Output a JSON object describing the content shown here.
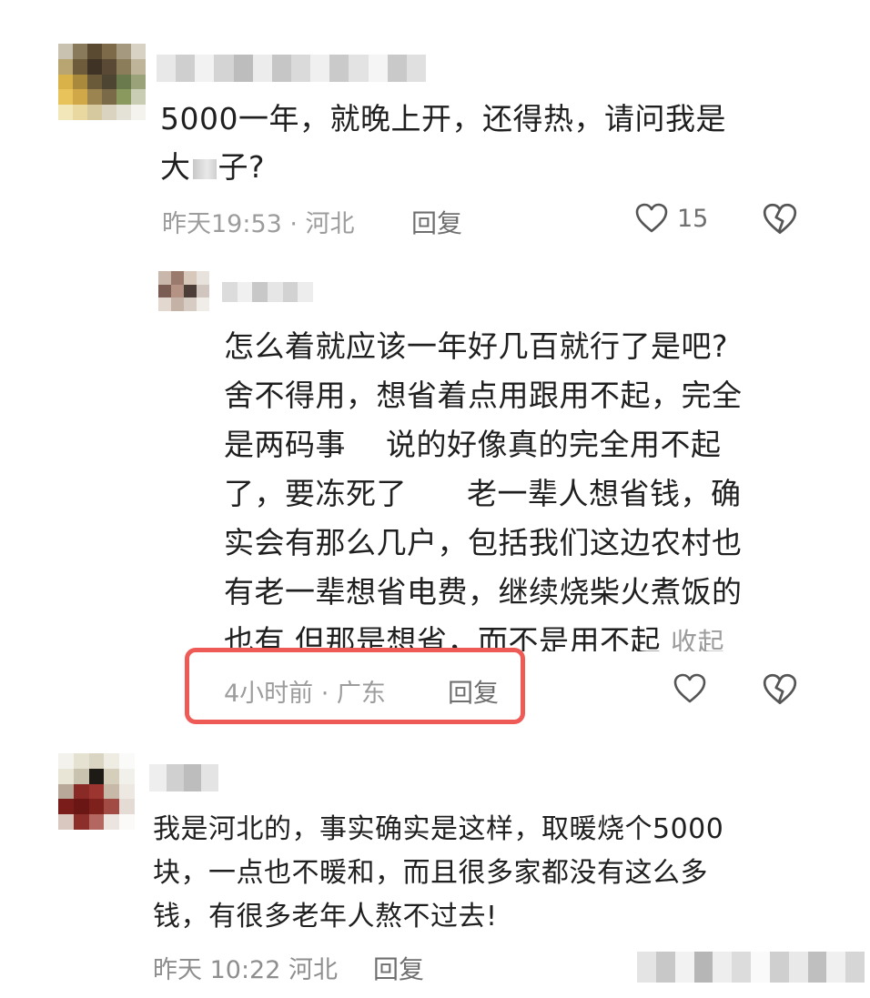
{
  "comments": [
    {
      "text_prefix": "5000一年，就晚上开，还得热，请问我是",
      "text_line2_a": "大",
      "text_line2_b": "子?",
      "time": "昨天19:53 · 河北",
      "reply_label": "回复",
      "like_count": "15",
      "like_icon": "heart-outline-icon",
      "dislike_icon": "broken-heart-icon",
      "reply": {
        "lines": [
          "怎么着就应该一年好几百就行了是吧?",
          "舍不得用，想省着点用跟用不起，完全",
          "是两码事    说的好像真的完全用不起",
          "了，要冻死了      老一辈人想省钱，确",
          "实会有那么几户，包括我们这边农村也",
          "有老一辈想省电费，继续烧柴火煮饭的",
          "也有 但那是想省，而不是用不起"
        ],
        "collapse_label": "收起",
        "time": "4小时前 · 广东",
        "reply_label": "回复",
        "like_icon": "heart-outline-icon",
        "dislike_icon": "broken-heart-icon"
      }
    },
    {
      "lines": [
        "我是河北的，事实确实是这样，取暖烧个5000",
        "块，一点也不暖和，而且很多家都没有这么多",
        "钱，有很多老年人熬不过去!"
      ],
      "time": "昨天 10:22 河北",
      "reply_label": "回复"
    }
  ],
  "colors": {
    "highlight_border": "#ee5a56",
    "meta_text": "#9c9c9c"
  }
}
